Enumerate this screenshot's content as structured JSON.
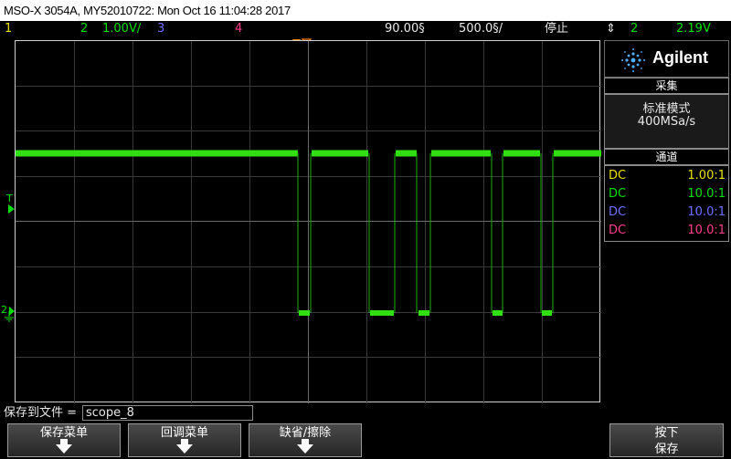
{
  "title": "MSO-X 3054A, MY52010722: Mon Oct 16 11:04:28 2017",
  "status": {
    "ch1_label": "1",
    "ch2_label": "2",
    "ch2_scale": "1.00V/",
    "ch3_label": "3",
    "ch4_label": "4",
    "time_ref": "90.00§",
    "time_scale": "500.0§/",
    "run_state": "停止",
    "trig_source": "2",
    "trig_level": "2.19V",
    "colors": {
      "ch1": "#e8e000",
      "ch2": "#00e000",
      "ch3": "#6f6fff",
      "ch4": "#ff3c8c"
    }
  },
  "sidebar": {
    "brand": "Agilent",
    "acq_header": "采集",
    "acq_mode": "标准模式",
    "acq_rate": "400MSa/s",
    "chan_header": "通道",
    "channels": [
      {
        "coupling": "DC",
        "probe": "1.00:1"
      },
      {
        "coupling": "DC",
        "probe": "10.0:1"
      },
      {
        "coupling": "DC",
        "probe": "10.0:1"
      },
      {
        "coupling": "DC",
        "probe": "10.0:1"
      }
    ]
  },
  "markers": {
    "trigger_marker": "T",
    "ch2_marker": "2"
  },
  "file": {
    "label": "保存到文件 =",
    "value": "scope_8"
  },
  "softkeys": [
    {
      "label": "保存菜单"
    },
    {
      "label": "回调菜单"
    },
    {
      "label": "缺省/擦除"
    },
    {
      "label_line1": "按下",
      "label_line2": "保存"
    }
  ]
}
